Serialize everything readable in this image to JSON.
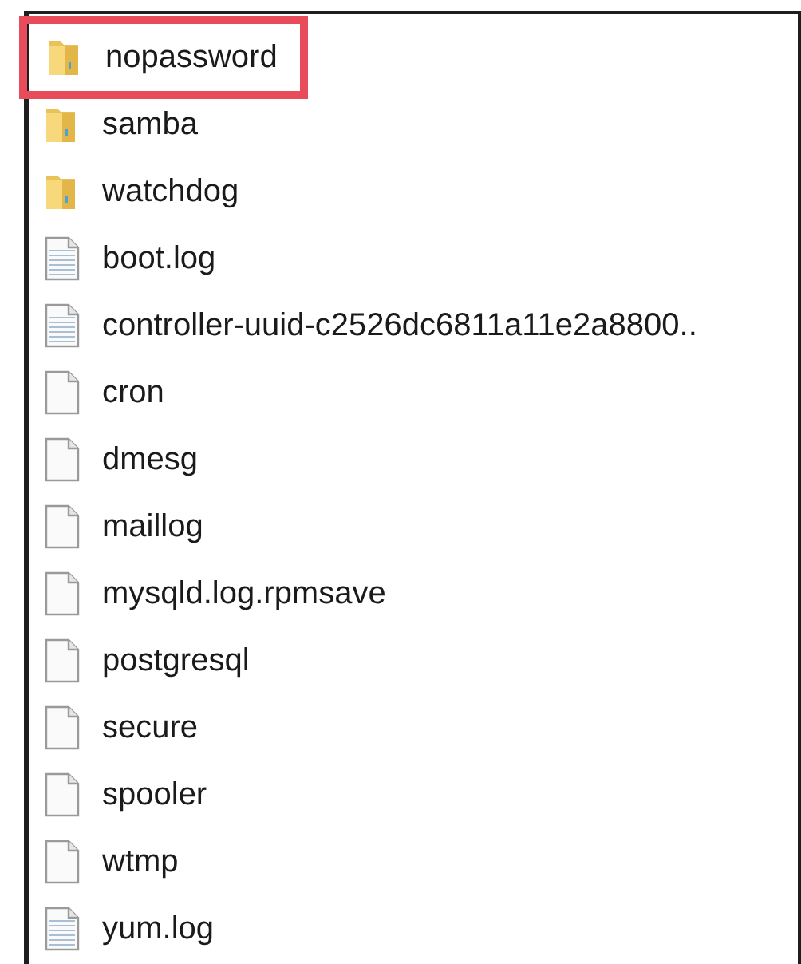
{
  "files": [
    {
      "name": "nopassword",
      "kind": "folder",
      "highlighted": true
    },
    {
      "name": "samba",
      "kind": "folder",
      "highlighted": false
    },
    {
      "name": "watchdog",
      "kind": "folder",
      "highlighted": false
    },
    {
      "name": "boot.log",
      "kind": "text",
      "highlighted": false
    },
    {
      "name": "controller-uuid-c2526dc6811a11e2a8800..",
      "kind": "text",
      "highlighted": false
    },
    {
      "name": "cron",
      "kind": "blank",
      "highlighted": false
    },
    {
      "name": "dmesg",
      "kind": "blank",
      "highlighted": false
    },
    {
      "name": "maillog",
      "kind": "blank",
      "highlighted": false
    },
    {
      "name": "mysqld.log.rpmsave",
      "kind": "blank",
      "highlighted": false
    },
    {
      "name": "postgresql",
      "kind": "blank",
      "highlighted": false
    },
    {
      "name": "secure",
      "kind": "blank",
      "highlighted": false
    },
    {
      "name": "spooler",
      "kind": "blank",
      "highlighted": false
    },
    {
      "name": "wtmp",
      "kind": "blank",
      "highlighted": false
    },
    {
      "name": "yum.log",
      "kind": "text",
      "highlighted": false
    }
  ]
}
